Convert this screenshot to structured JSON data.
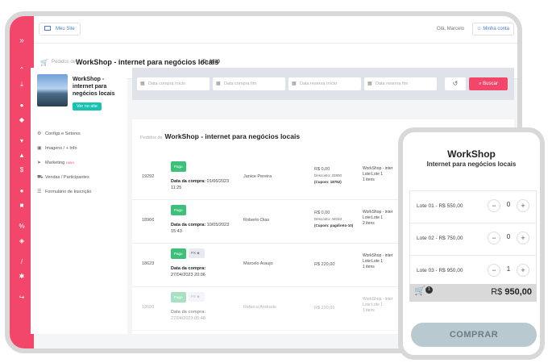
{
  "topbar": {
    "site_button": "Meu Site",
    "greeting": "Olá, Marcelo",
    "account_button": "Minha conta"
  },
  "header": {
    "breadcrumb_prefix": "Pedidos de",
    "event_name": "WorkShop - internet para negócios locais",
    "event_id": "ID: 2930"
  },
  "event_panel": {
    "title": "WorkShop - internet para negócios locais",
    "site_button": "Ver no site",
    "menu": [
      {
        "label": "Configs e Setores"
      },
      {
        "label": "Imagens / + Info"
      },
      {
        "label": "Marketing",
        "badge": "novo"
      },
      {
        "label": "Vendas / Participantes"
      },
      {
        "label": "Formulário de Inscrição"
      }
    ]
  },
  "filters": {
    "date_purchase_start": "Data compra Início",
    "date_purchase_end": "Data compra fim",
    "date_reserve_start": "Data reserva Início",
    "date_reserve_end": "Data reserva fim",
    "search_button": "Buscar"
  },
  "orders": {
    "title_prefix": "Pedidos de",
    "title": "WorkShop - internet para negócios locais",
    "rows": [
      {
        "id": "19292",
        "status": "Pago",
        "date_label": "Data da compra:",
        "date": "01/06/2023",
        "time": "11:25",
        "name": "Janice Pereira",
        "price": "R$ 0,00",
        "discount": "Desconto: 22800",
        "coupon": "(Cupom: 18762)",
        "ticket_event": "WorkShop - inter",
        "ticket_lot": "Lote:Lote 1",
        "ticket_count": "1 itens"
      },
      {
        "id": "18966",
        "status": "Pago",
        "date_label": "Data da compra:",
        "date": "10/05/2023",
        "time": "15:43",
        "name": "Roberto Dias",
        "price": "R$ 0,00",
        "discount": "Desconto: 44033",
        "coupon": "(Cupom: pagdireto-10)",
        "ticket_event": "WorkShop - inter",
        "ticket_lot": "Lote:Lote 1",
        "ticket_count": "2 itens"
      },
      {
        "id": "18623",
        "status": "Pago",
        "method": "PX",
        "date_label": "Data da compra:",
        "date": "27/04/2023 20:06",
        "name": "Marcelo Araujo",
        "price": "R$ 220,00",
        "ticket_event": "WorkShop - inter",
        "ticket_lot": "Lote:Lote 1",
        "ticket_count": "1 itens"
      },
      {
        "id": "18600",
        "status": "Pago",
        "method": "PX",
        "date_label": "Data da compra:",
        "date": "27/04/2023 05:48",
        "name": "Rebeca Andrade",
        "price": "R$ 220,00",
        "ticket_event": "WorkShop - inter",
        "ticket_lot": "Lote:Lote 1",
        "ticket_count": "1 itens"
      }
    ]
  },
  "phone": {
    "title": "WorkShop",
    "subtitle": "Internet para negócios locais",
    "lots": [
      {
        "label": "Lote 01 - R$ 550,00",
        "qty": "0"
      },
      {
        "label": "Lote 02 - R$ 750,00",
        "qty": "0"
      },
      {
        "label": "Lote 03 - R$ 950,00",
        "qty": "1"
      }
    ],
    "cart_count": "1",
    "total_currency": "R$",
    "total_value": "950,00",
    "buy_button": "COMPRAR"
  },
  "colors": {
    "accent": "#f2476a",
    "paid": "#3cc07a",
    "site_button": "#19c3b0",
    "buy_button": "#b9c9d0"
  }
}
